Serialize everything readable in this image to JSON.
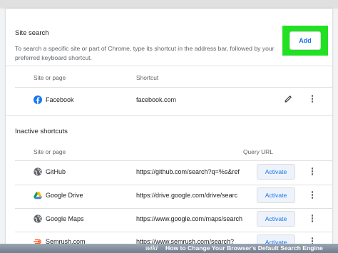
{
  "site_search": {
    "title": "Site search",
    "description": "To search a specific site or part of Chrome, type its shortcut in the address bar, followed by your preferred keyboard shortcut.",
    "add_label": "Add",
    "columns": {
      "site": "Site or page",
      "shortcut": "Shortcut"
    },
    "rows": [
      {
        "name": "Facebook",
        "shortcut": "facebook.com",
        "icon": "facebook-icon"
      }
    ]
  },
  "inactive": {
    "title": "Inactive shortcuts",
    "columns": {
      "site": "Site or page",
      "query": "Query URL"
    },
    "activate_label": "Activate",
    "rows": [
      {
        "name": "GitHub",
        "url": "https://github.com/search?q=%s&ref",
        "icon": "globe-icon"
      },
      {
        "name": "Google Drive",
        "url": "https://drive.google.com/drive/searc",
        "icon": "google-drive-icon"
      },
      {
        "name": "Google Maps",
        "url": "https://www.google.com/maps/search",
        "icon": "globe-icon"
      },
      {
        "name": "Semrush.com",
        "url": "https://www.semrush.com/search?",
        "icon": "semrush-icon"
      }
    ]
  },
  "footer": {
    "brand": "wiki",
    "caption": "How to Change Your Browser's Default Search Engine"
  },
  "colors": {
    "highlight": "#22e022",
    "accent": "#1a73e8",
    "facebook": "#1877f2",
    "semrush": "#ff642d"
  }
}
